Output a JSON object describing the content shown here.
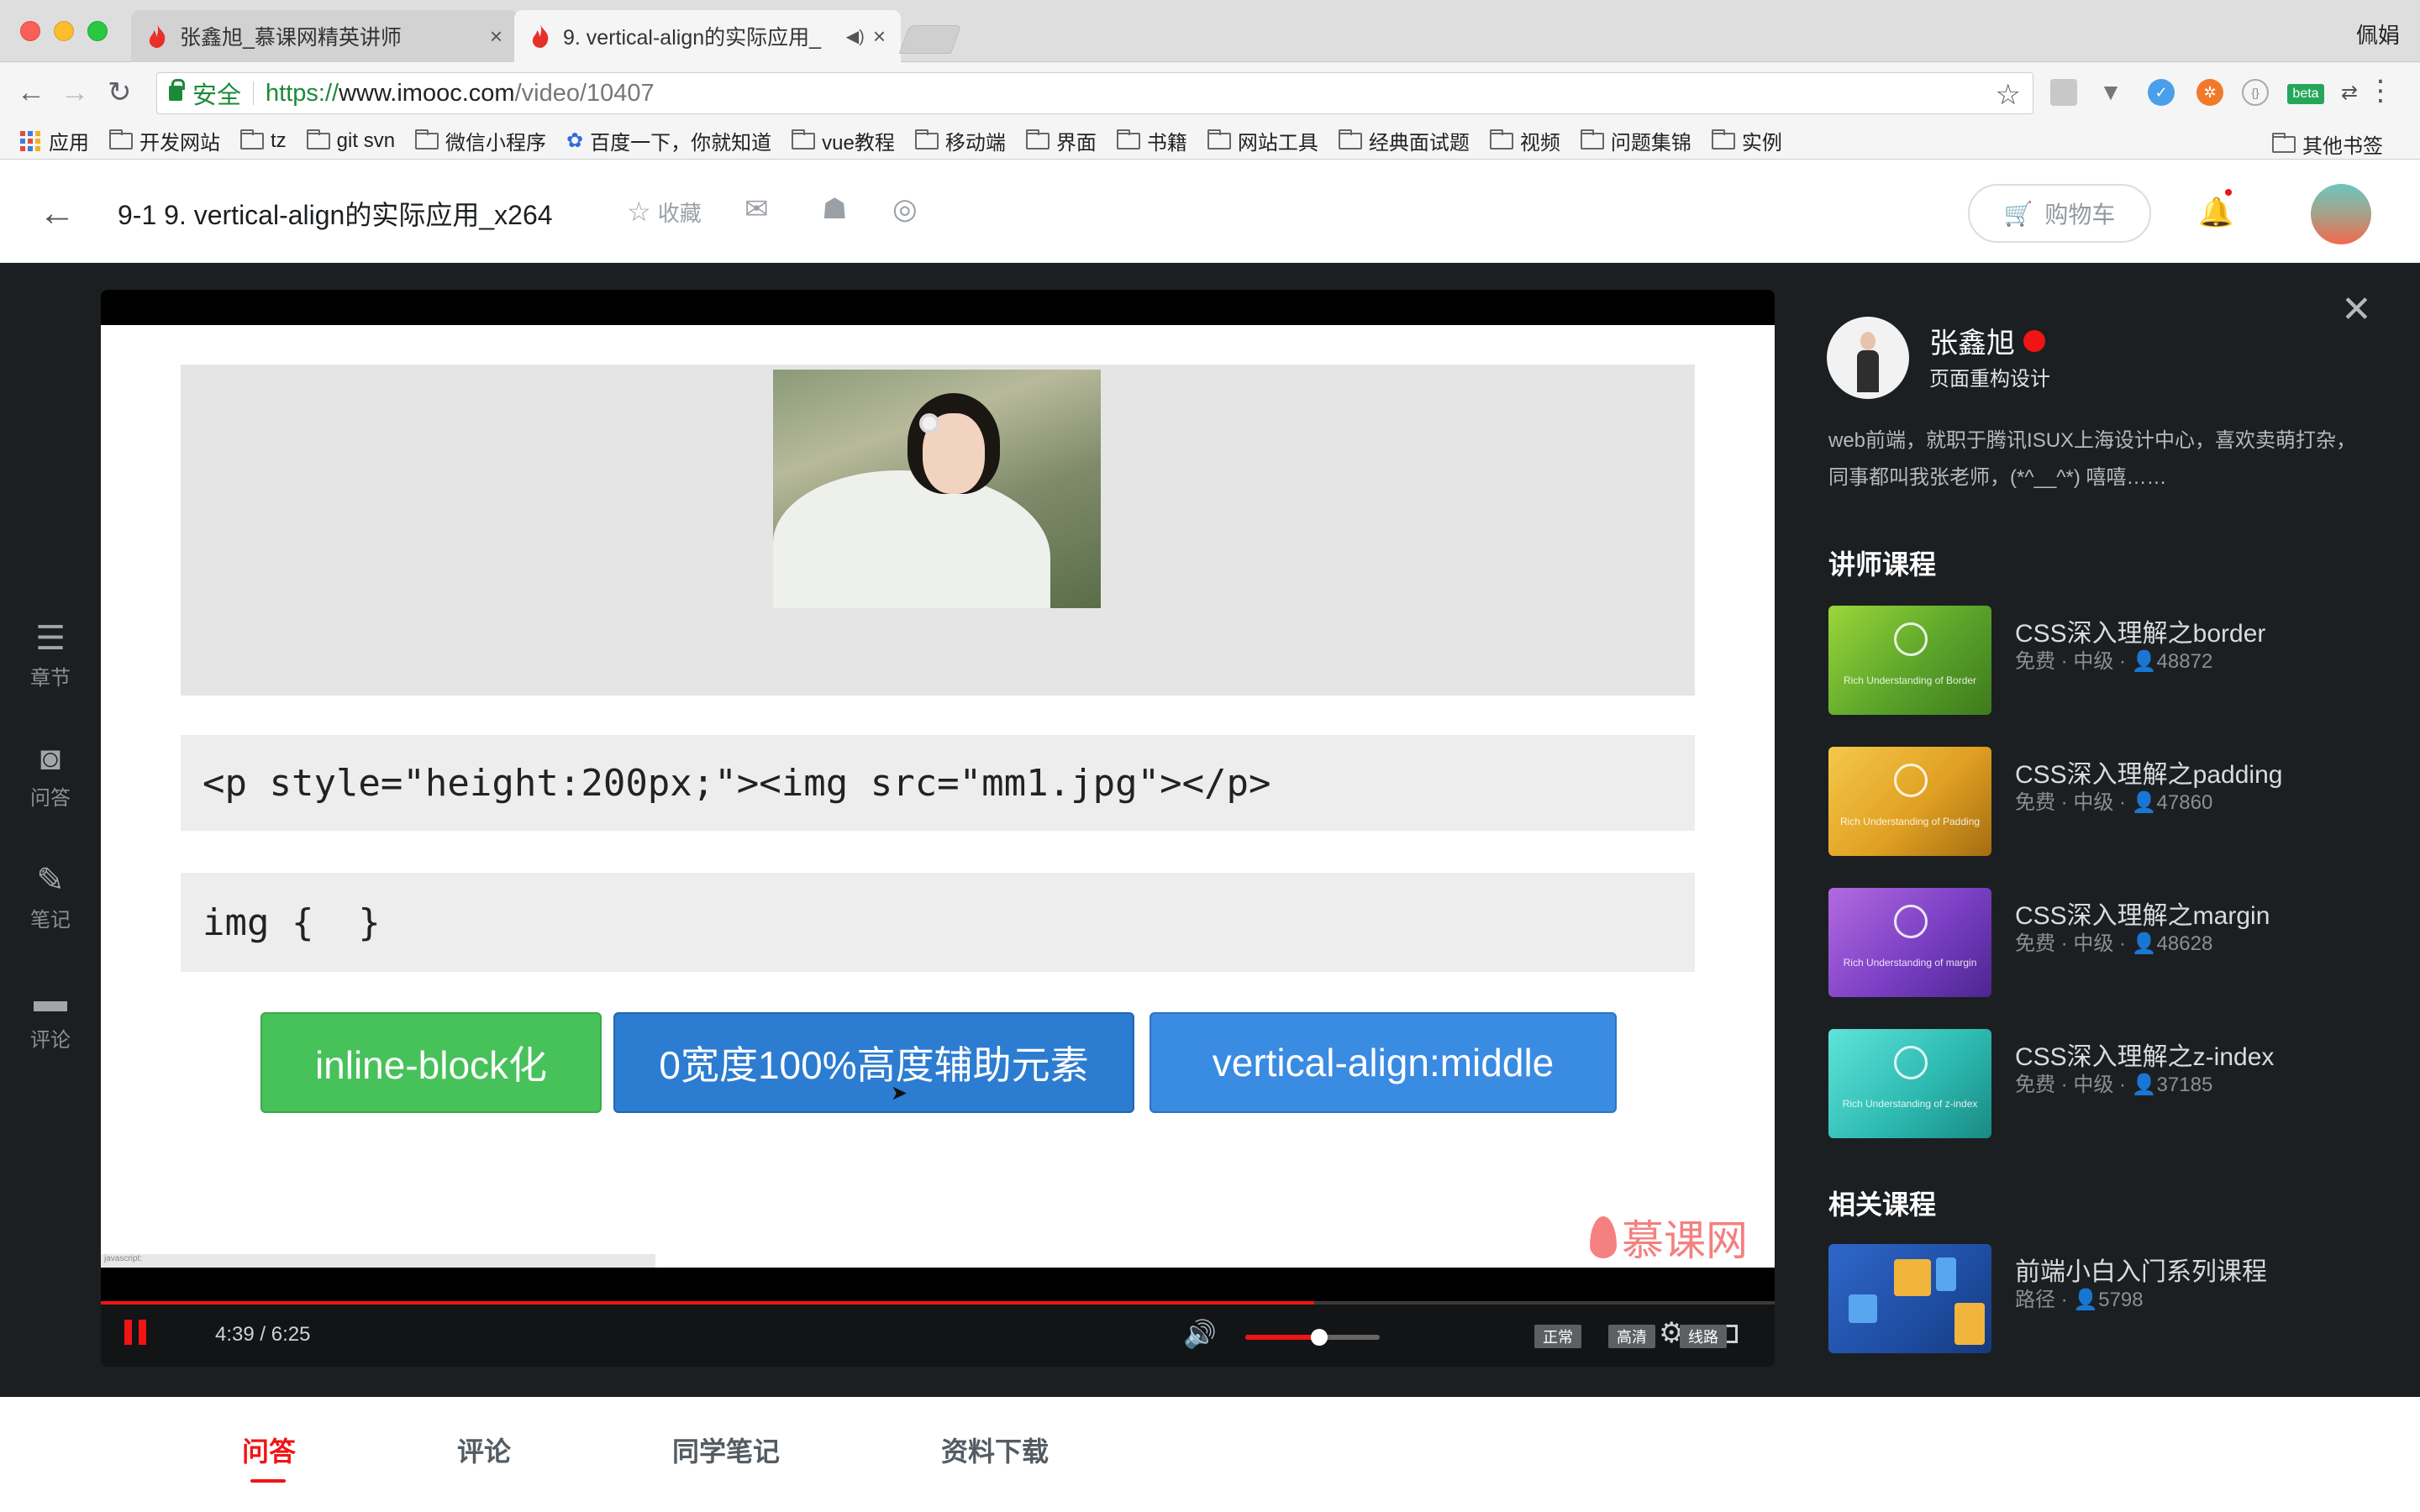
{
  "browser": {
    "tabs": [
      {
        "title": "张鑫旭_慕课网精英讲师"
      },
      {
        "title": "9. vertical-align的实际应用_"
      }
    ],
    "profile": "佩娟",
    "address": {
      "secure_label": "安全",
      "url_scheme": "https://",
      "url_host": "www.imooc.com",
      "url_path": "/video/10407"
    },
    "bookmarks": [
      "开发网站",
      "tz",
      "git svn",
      "微信小程序",
      "百度一下，你就知道",
      "vue教程",
      "移动端",
      "界面",
      "书籍",
      "网站工具",
      "经典面试题",
      "视频",
      "问题集锦",
      "实例"
    ],
    "apps_label": "应用",
    "other_bookmarks": "其他书签",
    "ext_beta": "beta"
  },
  "header": {
    "title": "9-1 9. vertical-align的实际应用_x264",
    "collect": "收藏",
    "cart": "购物车"
  },
  "side_nav": [
    "章节",
    "问答",
    "笔记",
    "评论"
  ],
  "slide": {
    "code1": "<p style=\"height:200px;\"><img src=\"mm1.jpg\"></p>",
    "code2": "img {  }",
    "options": [
      "inline-block化",
      "0宽度100%高度辅助元素",
      "vertical-align:middle"
    ],
    "watermark": "慕课网",
    "js_strip": "javascript:"
  },
  "player": {
    "time": "4:39 / 6:25",
    "progress": 0.725,
    "volume": 0.55,
    "buttons": [
      "正常",
      "高清",
      "线路"
    ]
  },
  "teacher": {
    "name": "张鑫旭",
    "role": "页面重构设计",
    "bio": "web前端，就职于腾讯ISUX上海设计中心，喜欢卖萌打杂，同事都叫我张老师，(*^__^*) 嘻嘻……"
  },
  "sections": {
    "teacher_courses": "讲师课程",
    "related_courses": "相关课程"
  },
  "courses": [
    {
      "name": "CSS深入理解之border",
      "meta": "免费 · 中级 · ",
      "count": "48872",
      "emblem": "Rich Understanding of Border"
    },
    {
      "name": "CSS深入理解之padding",
      "meta": "免费 · 中级 · ",
      "count": "47860",
      "emblem": "Rich Understanding of Padding"
    },
    {
      "name": "CSS深入理解之margin",
      "meta": "免费 · 中级 · ",
      "count": "48628",
      "emblem": "Rich Understanding of margin"
    },
    {
      "name": "CSS深入理解之z-index",
      "meta": "免费 · 中级 · ",
      "count": "37185",
      "emblem": "Rich Understanding of z-index"
    }
  ],
  "related": {
    "name": "前端小白入门系列课程",
    "meta": "路径 · ",
    "count": "5798"
  },
  "bottom_tabs": [
    "问答",
    "评论",
    "同学笔记",
    "资料下载"
  ]
}
